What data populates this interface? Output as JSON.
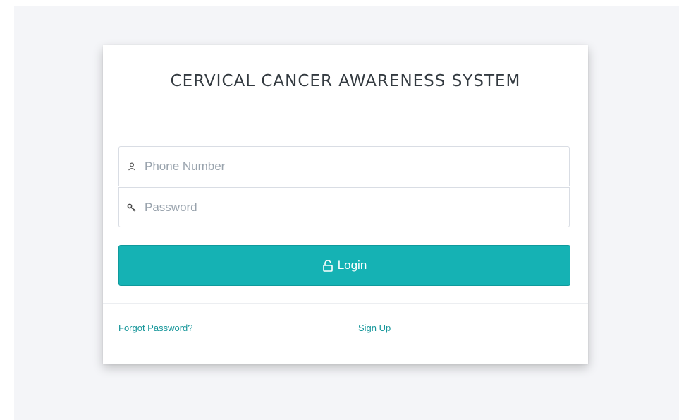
{
  "login_card": {
    "title": "CERVICAL CANCER AWARENESS SYSTEM",
    "phone_field": {
      "placeholder": "Phone Number",
      "value": "",
      "icon": "user-icon"
    },
    "password_field": {
      "placeholder": "Password",
      "value": "",
      "icon": "key-icon"
    },
    "login_button": {
      "label": "Login",
      "icon": "unlock-icon"
    },
    "links": {
      "forgot_password": "Forgot Password?",
      "sign_up": "Sign Up"
    }
  },
  "colors": {
    "accent": "#15b2b4",
    "link": "#16969a",
    "background": "#f4f5f8"
  }
}
